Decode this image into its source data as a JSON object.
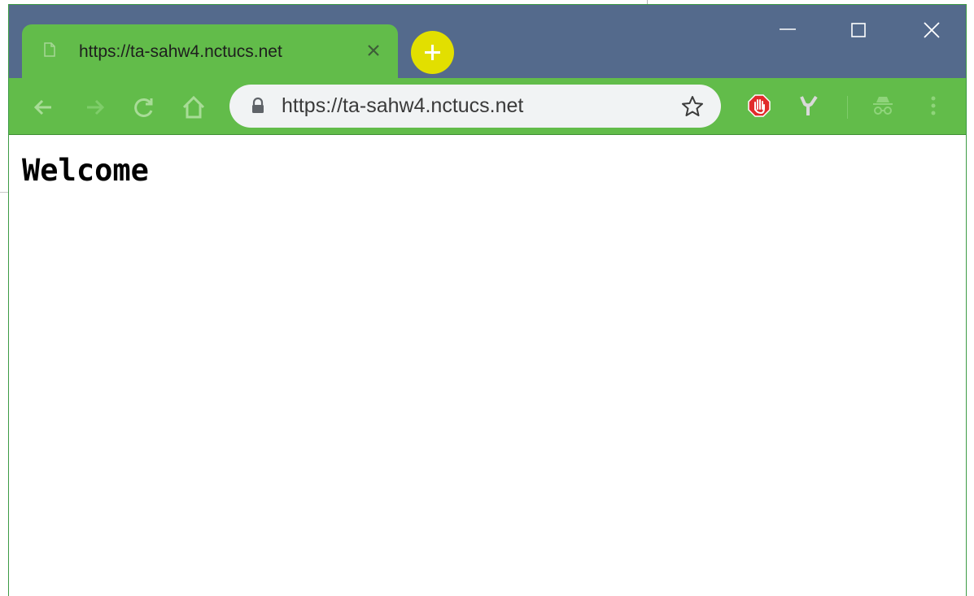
{
  "browser": {
    "tab": {
      "title": "https://ta-sahw4.nctucs.net",
      "icon": "document-icon",
      "close_icon": "close-icon"
    },
    "new_tab_icon": "plus-icon",
    "window_controls": [
      "minimize-icon",
      "maximize-icon",
      "close-icon"
    ],
    "toolbar": {
      "buttons": [
        "back-arrow-icon",
        "forward-arrow-icon",
        "reload-icon",
        "home-icon"
      ],
      "address": {
        "value": "https://ta-sahw4.nctucs.net",
        "secure_icon": "lock-icon",
        "bookmark_icon": "star-icon"
      },
      "extensions": [
        "stop-hand-extension-icon",
        "tuning-fork-extension-icon",
        "incognito-icon",
        "more-menu-icon"
      ]
    },
    "colors": {
      "titlebar": "#546a8c",
      "toolbar": "#62bc4a",
      "new_tab": "#e2df00",
      "omnibox": "#f1f3f4"
    }
  },
  "page": {
    "heading": "Welcome"
  }
}
